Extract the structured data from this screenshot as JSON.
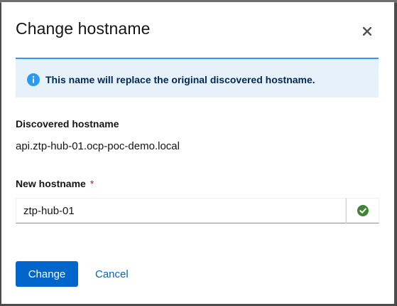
{
  "modal": {
    "title": "Change hostname",
    "alert_text": "This name will replace the original discovered hostname.",
    "discovered_label": "Discovered hostname",
    "discovered_value": "api.ztp-hub-01.ocp-poc-demo.local",
    "new_label": "New hostname",
    "required_mark": "*",
    "new_value": "ztp-hub-01",
    "primary_button": "Change",
    "cancel_button": "Cancel"
  },
  "colors": {
    "primary": "#0066cc",
    "info_bg": "#e7f1fa",
    "info_accent": "#2b9af3",
    "success": "#3e8635",
    "required": "#c9190b"
  },
  "icons": {
    "close": "close-icon",
    "info": "info-circle-icon",
    "valid": "check-circle-icon"
  }
}
